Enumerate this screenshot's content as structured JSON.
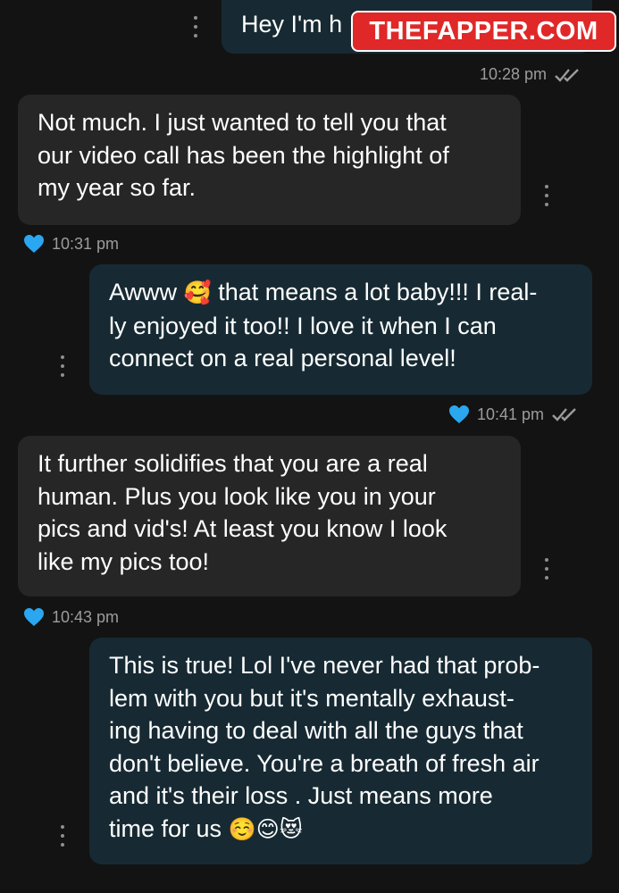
{
  "watermark": "THEFAPPER.COM",
  "messages": [
    {
      "direction": "sent",
      "lines": [
        "Hey I'm h"
      ]
    },
    {
      "direction": "received",
      "lines": [
        "Not much. I just wanted to tell you that",
        "our video call has been the highlight of",
        "my year so far."
      ]
    },
    {
      "direction": "sent",
      "lines": [
        "Awww",
        "that means a lot baby!!! I real-",
        "ly enjoyed it too!! I love it when I can",
        "connect on a real personal level!"
      ],
      "emoji": [
        "🥰"
      ]
    },
    {
      "direction": "received",
      "lines": [
        "It further solidifies that you are a real",
        "human. Plus you look like you in your",
        "pics and vid's! At least you know I look",
        "like my pics too!"
      ]
    },
    {
      "direction": "sent",
      "lines": [
        "This is true! Lol I've never had that prob-",
        "lem with you but it's mentally exhaust-",
        "ing having to deal with all the guys that",
        "don't believe. You're a breath of fresh air",
        "and it's their loss . Just means more",
        "time for us"
      ],
      "emoji": [
        "☺️",
        "😊",
        "😻"
      ]
    }
  ],
  "timestamps": {
    "t1": "10:28 pm",
    "t2": "10:31 pm",
    "t3": "10:41 pm",
    "t4": "10:43 pm"
  },
  "icons": {
    "heart": "heart-icon",
    "read": "double-check-icon",
    "menu": "more-vertical-icon"
  },
  "colors": {
    "background": "#131313",
    "received_bubble": "#262626",
    "sent_bubble": "#172a33",
    "heart": "#2aa7f0",
    "watermark": "#e02828"
  }
}
